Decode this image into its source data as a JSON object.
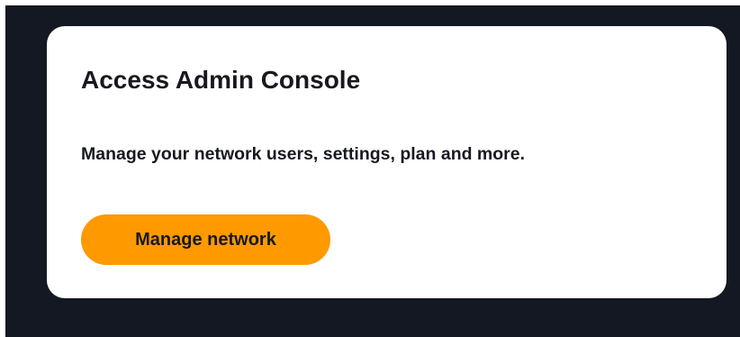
{
  "card": {
    "title": "Access Admin Console",
    "description": "Manage your network users, settings, plan and more.",
    "button_label": "Manage network"
  },
  "colors": {
    "background": "#131822",
    "card": "#ffffff",
    "accent": "#ff9900",
    "text": "#16191f"
  }
}
